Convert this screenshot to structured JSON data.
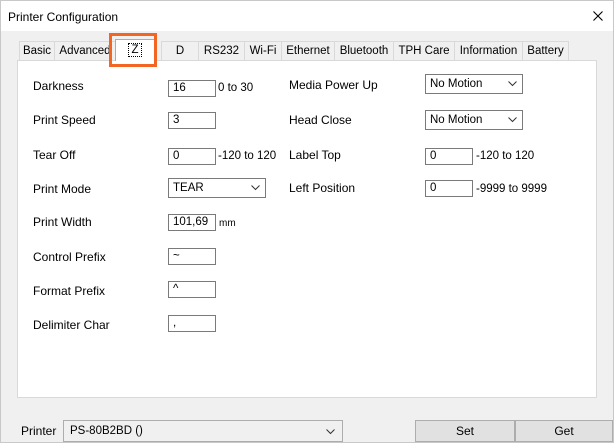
{
  "window": {
    "title": "Printer Configuration"
  },
  "tabs": [
    {
      "label": "Basic"
    },
    {
      "label": "Advanced"
    },
    {
      "label": "Z"
    },
    {
      "label": "D"
    },
    {
      "label": "RS232"
    },
    {
      "label": "Wi-Fi"
    },
    {
      "label": "Ethernet"
    },
    {
      "label": "Bluetooth"
    },
    {
      "label": "TPH Care"
    },
    {
      "label": "Information"
    },
    {
      "label": "Battery"
    }
  ],
  "active_tab": "Z",
  "highlight_color": "#f26522",
  "left_settings": {
    "darkness": {
      "label": "Darkness",
      "value": "16",
      "hint": "0 to 30"
    },
    "print_speed": {
      "label": "Print Speed",
      "value": "3"
    },
    "tear_off": {
      "label": "Tear Off",
      "value": "0",
      "hint": "-120 to 120"
    },
    "print_mode": {
      "label": "Print Mode",
      "value": "TEAR"
    },
    "print_width": {
      "label": "Print Width",
      "value": "101,69",
      "hint": "mm"
    },
    "control_prefix": {
      "label": "Control Prefix",
      "value": "~"
    },
    "format_prefix": {
      "label": "Format Prefix",
      "value": "^"
    },
    "delimiter_char": {
      "label": "Delimiter Char",
      "value": ","
    }
  },
  "right_settings": {
    "media_power_up": {
      "label": "Media Power Up",
      "value": "No Motion"
    },
    "head_close": {
      "label": "Head Close",
      "value": "No Motion"
    },
    "label_top": {
      "label": "Label Top",
      "value": "0",
      "hint": "-120 to 120"
    },
    "left_position": {
      "label": "Left Position",
      "value": "0",
      "hint": "-9999 to 9999"
    }
  },
  "bottom": {
    "printer_label": "Printer",
    "printer_value": "PS-80B2BD ()",
    "set_label": "Set",
    "get_label": "Get"
  }
}
